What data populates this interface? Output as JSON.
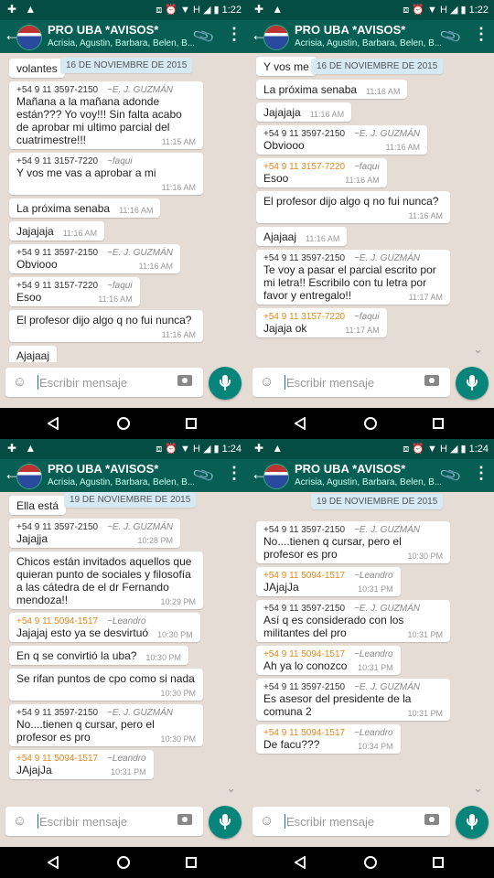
{
  "panels": [
    {
      "status": {
        "left_icons": "✚ ▲",
        "right_icons": "⧈ ⏰ ▼ H ◢ ▮",
        "time": "1:22"
      },
      "header": {
        "title": "PRO UBA *AVISOS*",
        "subtitle": "Acrisia, Agustin, Barbara, Belen, B..."
      },
      "date_chip": "16 DE NOVIEMBRE DE 2015",
      "messages": [
        {
          "sender": "",
          "alias": "",
          "text": "volantes",
          "time": "",
          "color": ""
        },
        {
          "sender": "+54 9 11 3597-2150",
          "alias": "~E. J. GUZMÁN",
          "text": "Mañana a la mañana adonde están??? Yo voy!!! Sin falta acabo de aprobar mi ultimo parcial del cuatrimestre!!!",
          "time": "11:15 AM",
          "color": "grey"
        },
        {
          "sender": "+54 9 11 3157-7220",
          "alias": "~faqui",
          "text": "Y vos me vas a aprobar a mi",
          "time": "11:16 AM",
          "color": "grey"
        },
        {
          "sender": "",
          "alias": "",
          "text": "La próxima senaba",
          "time": "11:16 AM",
          "color": ""
        },
        {
          "sender": "",
          "alias": "",
          "text": "Jajajaja",
          "time": "11:16 AM",
          "color": ""
        },
        {
          "sender": "+54 9 11 3597-2150",
          "alias": "~E. J. GUZMÁN",
          "text": "Obviooo",
          "time": "11:16 AM",
          "color": "grey"
        },
        {
          "sender": "+54 9 11 3157-7220",
          "alias": "~faqui",
          "text": "Esoo",
          "time": "11:16 AM",
          "color": "grey"
        },
        {
          "sender": "",
          "alias": "",
          "text": "El profesor dijo algo q no fui nunca?",
          "time": "11:16 AM",
          "color": ""
        },
        {
          "sender": "",
          "alias": "",
          "text": "Ajajaaj",
          "time": "",
          "color": ""
        }
      ],
      "input_placeholder": "Escribir mensaje"
    },
    {
      "status": {
        "left_icons": "✚ ▲",
        "right_icons": "⧈ ⏰ ▼ H ◢ ▮",
        "time": "1:22"
      },
      "header": {
        "title": "PRO UBA *AVISOS*",
        "subtitle": "Acrisia, Agustin, Barbara, Belen, B..."
      },
      "date_chip": "16 DE NOVIEMBRE DE 2015",
      "messages": [
        {
          "sender": "",
          "alias": "",
          "text": "Y vos me",
          "time": "",
          "color": ""
        },
        {
          "sender": "",
          "alias": "",
          "text": "La próxima senaba",
          "time": "11:16 AM",
          "color": ""
        },
        {
          "sender": "",
          "alias": "",
          "text": "Jajajaja",
          "time": "11:16 AM",
          "color": ""
        },
        {
          "sender": "+54 9 11 3597-2150",
          "alias": "~E. J. GUZMÁN",
          "text": "Obviooo",
          "time": "11:16 AM",
          "color": "grey"
        },
        {
          "sender": "+54 9 11 3157-7220",
          "alias": "~faqui",
          "text": "Esoo",
          "time": "11:16 AM",
          "color": "orange"
        },
        {
          "sender": "",
          "alias": "",
          "text": "El profesor dijo algo q no fui nunca?",
          "time": "11:16 AM",
          "color": ""
        },
        {
          "sender": "",
          "alias": "",
          "text": "Ajajaaj",
          "time": "11:16 AM",
          "color": ""
        },
        {
          "sender": "+54 9 11 3597-2150",
          "alias": "~E. J. GUZMÁN",
          "text": "Te voy a pasar el parcial escrito por mi letra!! Escribilo con tu letra por favor y entregalo!!",
          "time": "11:17 AM",
          "color": "grey"
        },
        {
          "sender": "+54 9 11 3157-7220",
          "alias": "~faqui",
          "text": "Jajaja ok",
          "time": "11:17 AM",
          "color": "orange"
        }
      ],
      "input_placeholder": "Escribir mensaje"
    },
    {
      "status": {
        "left_icons": "✚ ▲",
        "right_icons": "⧈ ⏰ ▼ H ◢ ▮",
        "time": "1:24"
      },
      "header": {
        "title": "PRO UBA *AVISOS*",
        "subtitle": "Acrisia, Agustin, Barbara, Belen, B..."
      },
      "date_chip": "19 DE NOVIEMBRE DE 2015",
      "messages": [
        {
          "sender": "",
          "alias": "",
          "text": "Ella está",
          "time": "",
          "color": ""
        },
        {
          "sender": "+54 9 11 3597-2150",
          "alias": "~E. J. GUZMÁN",
          "text": "Jajajja",
          "time": "10:28 PM",
          "color": "grey"
        },
        {
          "sender": "",
          "alias": "",
          "text": "Chicos están invitados aquellos que quieran punto de sociales y filosofía a las cátedra de el dr Fernando mendoza!!",
          "time": "10:29 PM",
          "color": ""
        },
        {
          "sender": "+54 9 11 5094-1517",
          "alias": "~Leandro",
          "text": "Jajajaj esto ya se desvirtuó",
          "time": "10:30 PM",
          "color": "orange"
        },
        {
          "sender": "",
          "alias": "",
          "text": "En q se convirtió la uba?",
          "time": "10:30 PM",
          "color": ""
        },
        {
          "sender": "",
          "alias": "",
          "text": "Se rifan puntos de cpo como si nada",
          "time": "10:30 PM",
          "color": ""
        },
        {
          "sender": "+54 9 11 3597-2150",
          "alias": "~E. J. GUZMÁN",
          "text": "No....tienen q cursar, pero el profesor es pro",
          "time": "10:30 PM",
          "color": "grey"
        },
        {
          "sender": "+54 9 11 5094-1517",
          "alias": "~Leandro",
          "text": "JAjajJa",
          "time": "10:31 PM",
          "color": "orange"
        }
      ],
      "input_placeholder": "Escribir mensaje"
    },
    {
      "status": {
        "left_icons": "✚ ▲",
        "right_icons": "⧈ ⏰ ▼ H ◢ ▮",
        "time": "1:24"
      },
      "header": {
        "title": "PRO UBA *AVISOS*",
        "subtitle": "Acrisia, Agustin, Barbara, Belen, B..."
      },
      "date_chip": "19 DE NOVIEMBRE DE 2015",
      "messages": [
        {
          "sender": "+54 9 11 3597-2150",
          "alias": "~E. J. GUZMÁN",
          "text": "No....tienen q cursar, pero el profesor es pro",
          "time": "10:30 PM",
          "color": "grey"
        },
        {
          "sender": "+54 9 11 5094-1517",
          "alias": "~Leandro",
          "text": "JAjajJa",
          "time": "10:31 PM",
          "color": "orange"
        },
        {
          "sender": "+54 9 11 3597-2150",
          "alias": "~E. J. GUZMÁN",
          "text": "Así q es considerado con los militantes del pro",
          "time": "10:31 PM",
          "color": "grey"
        },
        {
          "sender": "+54 9 11 5094-1517",
          "alias": "~Leandro",
          "text": "Ah ya lo conozco",
          "time": "10:31 PM",
          "color": "orange"
        },
        {
          "sender": "+54 9 11 3597-2150",
          "alias": "~E. J. GUZMÁN",
          "text": "Es asesor del presidente de la comuna 2",
          "time": "10:31 PM",
          "color": "grey"
        },
        {
          "sender": "+54 9 11 5094-1517",
          "alias": "~Leandro",
          "text": "De facu???",
          "time": "10:34 PM",
          "color": "orange"
        }
      ],
      "input_placeholder": "Escribir mensaje"
    }
  ]
}
